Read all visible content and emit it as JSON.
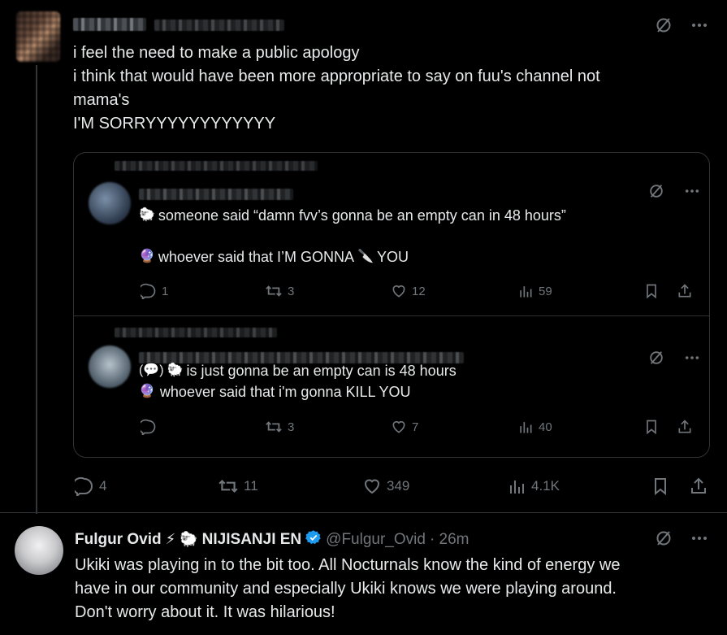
{
  "post1": {
    "lines": [
      "i feel the need to make a public apology",
      "i think that would have been more appropriate to say on fuu's channel not",
      "mama's",
      "I'M SORRYYYYYYYYYYYY"
    ],
    "stats": {
      "replies": "4",
      "reposts": "11",
      "likes": "349",
      "views": "4.1K"
    }
  },
  "quote1": {
    "line1": "someone said “damn fvv’s gonna be an empty can in 48 hours”",
    "line2_prefix": "whoever said that I’M GONNA",
    "line2_suffix": "YOU",
    "stats": {
      "replies": "1",
      "reposts": "3",
      "likes": "12",
      "views": "59"
    }
  },
  "quote2": {
    "line1": "is just gonna be an empty can is 48 hours",
    "line2": "whoever said that i'm gonna KILL YOU",
    "stats": {
      "reposts": "3",
      "likes": "7",
      "views": "40"
    }
  },
  "post2": {
    "name": "Fulgur Ovid",
    "org": "NIJISANJI EN",
    "handle": "@Fulgur_Ovid",
    "time": "· 26m",
    "lines": [
      "Ukiki was playing in to the bit too. All Nocturnals know the kind of energy we",
      "have in our community and especially Ukiki knows we were playing around.",
      "Don't worry about it. It was hilarious!"
    ]
  },
  "colors": {
    "background": "#000000",
    "text": "#e7e9ea",
    "muted": "#71767b",
    "border": "#2f3336",
    "verified": "#1d9bf0"
  }
}
